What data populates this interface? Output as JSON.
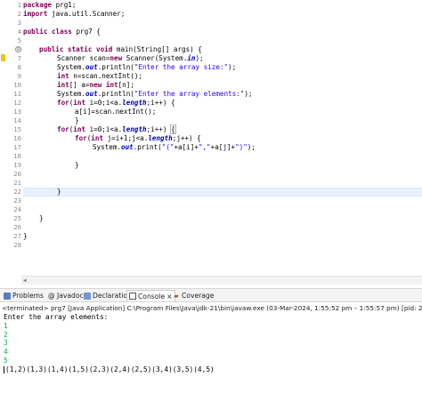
{
  "editor": {
    "line_numbers": [
      "1",
      "2",
      "3",
      "4",
      "5",
      "6",
      "7",
      "8",
      "9",
      "10",
      "11",
      "12",
      "13",
      "14",
      "15",
      "16",
      "17",
      "18",
      "19",
      "20",
      "21",
      "22",
      "23",
      "24",
      "25",
      "26",
      "27",
      "28"
    ],
    "fold_markers": [
      "⊖",
      "⊖"
    ]
  },
  "code": {
    "l1_kw": "package",
    "l1_rest": " prg1;",
    "l2_kw": "import",
    "l2_rest": " java.util.Scanner;",
    "l4_kw1": "public",
    "l4_kw2": "class",
    "l4_rest": " prg7 {",
    "l6_kw": "public static void",
    "l6_rest": " main(String[] args) {",
    "l7_a": "Scanner scan=",
    "l7_kw": "new",
    "l7_b": " Scanner(System.",
    "l7_fld": "in",
    "l7_c": ");",
    "l8_a": "System.",
    "l8_fld": "out",
    "l8_b": ".println(",
    "l8_str": "\"Enter the array size:\"",
    "l8_c": ");",
    "l9_kw": "int",
    "l9_rest": " n=scan.nextInt();",
    "l10_kw1": "int",
    "l10_a": "[] a=",
    "l10_kw2": "new",
    "l10_kw3": "int",
    "l10_b": "[n];",
    "l11_a": "System.",
    "l11_fld": "out",
    "l11_b": ".println(",
    "l11_str": "\"Enter the array elements:\"",
    "l11_c": ");",
    "l12_kw1": "for",
    "l12_a": "(",
    "l12_kw2": "int",
    "l12_b": " i=0;i<a.",
    "l12_fld": "length",
    "l12_c": ";i++) {",
    "l13": "a[i]=scan.nextInt();",
    "l14": "}",
    "l15_kw1": "for",
    "l15_a": "(",
    "l15_kw2": "int",
    "l15_b": " i=0;i<a.",
    "l15_fld": "length",
    "l15_c": ";i++) ",
    "l15_brace": "{",
    "l16_kw1": "for",
    "l16_a": "(",
    "l16_kw2": "int",
    "l16_b": " j=i+1;j<a.",
    "l16_fld": "length",
    "l16_c": ";j++) {",
    "l17_a": "System.",
    "l17_fld": "out",
    "l17_b": ".print(",
    "l17_str1": "\"(\"",
    "l17_c": "+a[i]+",
    "l17_str2": "\",\"",
    "l17_d": "+a[j]+",
    "l17_str3": "\")\"",
    "l17_e": ");",
    "l18": "}",
    "l22": "}",
    "l25": "}",
    "l27": "}"
  },
  "views": {
    "tabs": [
      {
        "label": "Problems",
        "icon": "problems-icon"
      },
      {
        "label": "@ Javadoc",
        "icon": "javadoc-icon"
      },
      {
        "label": "Declaration",
        "icon": "declaration-icon"
      },
      {
        "label": "Console",
        "icon": "console-icon",
        "close": "×"
      },
      {
        "label": "Coverage",
        "icon": "coverage-icon"
      }
    ],
    "status": "<terminated> prg7 [Java Application] C:\\Program Files\\Java\\jdk-21\\bin\\javaw.exe  (03-Mar-2024, 1:55:52 pm – 1:55:57 pm) [pid: 29476]"
  },
  "console": {
    "prompt": "Enter the array elements:",
    "inputs": [
      "1",
      "2",
      "3",
      "4",
      "5"
    ],
    "result": "(1,2)(1,3)(1,4)(1,5)(2,3)(2,4)(2,5)(3,4)(3,5)(4,5)"
  },
  "colors": {
    "keyword": "#7f0055",
    "string": "#2a00ff",
    "field": "#0000c0",
    "console_input": "#00b140",
    "current_line": "#e8f2fe"
  }
}
